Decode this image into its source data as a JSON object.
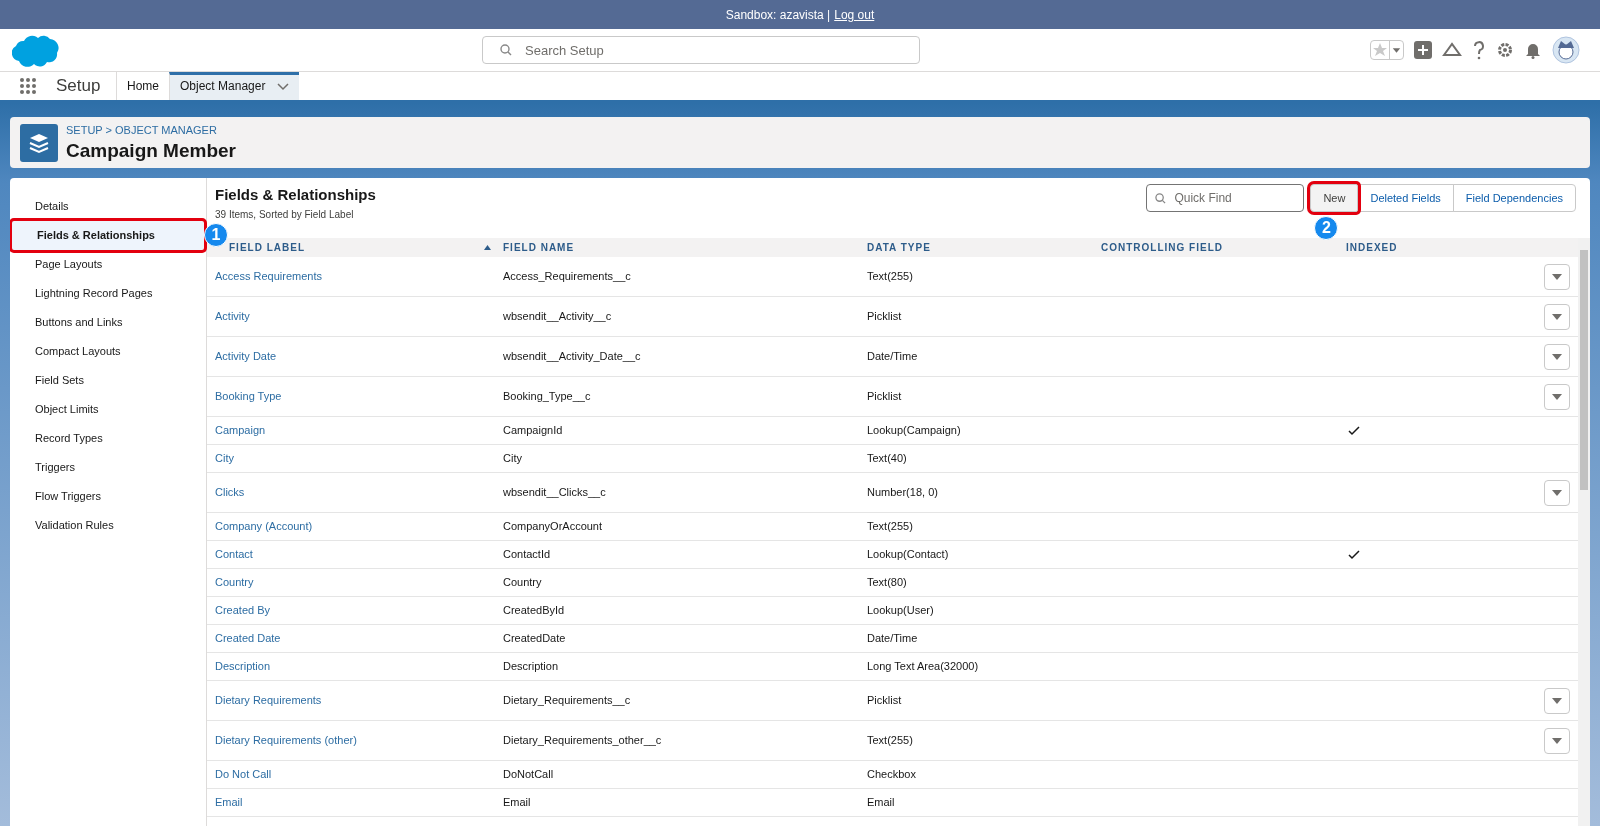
{
  "banner": {
    "text": "Sandbox: azavista |",
    "link": "Log out"
  },
  "search": {
    "placeholder": "Search Setup"
  },
  "nav": {
    "app_name": "Setup",
    "tabs": [
      {
        "label": "Home",
        "selected": false,
        "has_menu": false
      },
      {
        "label": "Object Manager",
        "selected": true,
        "has_menu": true
      }
    ]
  },
  "header": {
    "breadcrumb": "SETUP > OBJECT MANAGER",
    "title": "Campaign Member"
  },
  "sidebar": {
    "items": [
      {
        "label": "Details",
        "selected": false,
        "highlighted": false
      },
      {
        "label": "Fields & Relationships",
        "selected": true,
        "highlighted": true,
        "callout": "1"
      },
      {
        "label": "Page Layouts",
        "selected": false,
        "highlighted": false
      },
      {
        "label": "Lightning Record Pages",
        "selected": false,
        "highlighted": false
      },
      {
        "label": "Buttons and Links",
        "selected": false,
        "highlighted": false
      },
      {
        "label": "Compact Layouts",
        "selected": false,
        "highlighted": false
      },
      {
        "label": "Field Sets",
        "selected": false,
        "highlighted": false
      },
      {
        "label": "Object Limits",
        "selected": false,
        "highlighted": false
      },
      {
        "label": "Record Types",
        "selected": false,
        "highlighted": false
      },
      {
        "label": "Triggers",
        "selected": false,
        "highlighted": false
      },
      {
        "label": "Flow Triggers",
        "selected": false,
        "highlighted": false
      },
      {
        "label": "Validation Rules",
        "selected": false,
        "highlighted": false
      }
    ]
  },
  "section": {
    "title": "Fields & Relationships",
    "subtitle": "39 Items, Sorted by Field Label",
    "quick_find": {
      "placeholder": "Quick Find"
    },
    "buttons": [
      {
        "label": "New",
        "kind": "neutral",
        "highlighted": true,
        "callout": "2"
      },
      {
        "label": "Deleted Fields",
        "kind": "link",
        "highlighted": false
      },
      {
        "label": "Field Dependencies",
        "kind": "link",
        "highlighted": false
      }
    ]
  },
  "table": {
    "columns": [
      {
        "label": "FIELD LABEL",
        "sorted": true
      },
      {
        "label": "FIELD NAME",
        "sorted": false
      },
      {
        "label": "DATA TYPE",
        "sorted": false
      },
      {
        "label": "CONTROLLING FIELD",
        "sorted": false
      },
      {
        "label": "INDEXED",
        "sorted": false
      }
    ],
    "rows": [
      {
        "label": "Access Requirements",
        "name": "Access_Requirements__c",
        "type": "Text(255)",
        "indexed": false,
        "has_menu": true
      },
      {
        "label": "Activity",
        "name": "wbsendit__Activity__c",
        "type": "Picklist",
        "indexed": false,
        "has_menu": true
      },
      {
        "label": "Activity Date",
        "name": "wbsendit__Activity_Date__c",
        "type": "Date/Time",
        "indexed": false,
        "has_menu": true
      },
      {
        "label": "Booking Type",
        "name": "Booking_Type__c",
        "type": "Picklist",
        "indexed": false,
        "has_menu": true
      },
      {
        "label": "Campaign",
        "name": "CampaignId",
        "type": "Lookup(Campaign)",
        "indexed": true,
        "has_menu": false
      },
      {
        "label": "City",
        "name": "City",
        "type": "Text(40)",
        "indexed": false,
        "has_menu": false
      },
      {
        "label": "Clicks",
        "name": "wbsendit__Clicks__c",
        "type": "Number(18, 0)",
        "indexed": false,
        "has_menu": true
      },
      {
        "label": "Company (Account)",
        "name": "CompanyOrAccount",
        "type": "Text(255)",
        "indexed": false,
        "has_menu": false
      },
      {
        "label": "Contact",
        "name": "ContactId",
        "type": "Lookup(Contact)",
        "indexed": true,
        "has_menu": false
      },
      {
        "label": "Country",
        "name": "Country",
        "type": "Text(80)",
        "indexed": false,
        "has_menu": false
      },
      {
        "label": "Created By",
        "name": "CreatedById",
        "type": "Lookup(User)",
        "indexed": false,
        "has_menu": false
      },
      {
        "label": "Created Date",
        "name": "CreatedDate",
        "type": "Date/Time",
        "indexed": false,
        "has_menu": false
      },
      {
        "label": "Description",
        "name": "Description",
        "type": "Long Text Area(32000)",
        "indexed": false,
        "has_menu": false
      },
      {
        "label": "Dietary Requirements",
        "name": "Dietary_Requirements__c",
        "type": "Picklist",
        "indexed": false,
        "has_menu": true
      },
      {
        "label": "Dietary Requirements (other)",
        "name": "Dietary_Requirements_other__c",
        "type": "Text(255)",
        "indexed": false,
        "has_menu": true
      },
      {
        "label": "Do Not Call",
        "name": "DoNotCall",
        "type": "Checkbox",
        "indexed": false,
        "has_menu": false
      },
      {
        "label": "Email",
        "name": "Email",
        "type": "Email",
        "indexed": false,
        "has_menu": false
      }
    ]
  }
}
